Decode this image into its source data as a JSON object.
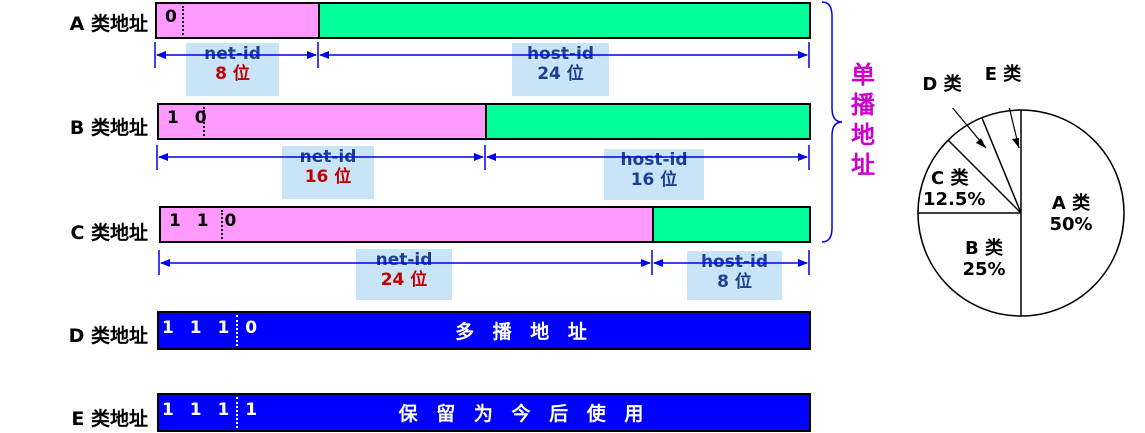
{
  "rows": {
    "a": {
      "label": "A 类地址",
      "prefix": "0",
      "net_label": "net-id",
      "net_bits": "8 位",
      "host_label": "host-id",
      "host_bits": "24 位"
    },
    "b": {
      "label": "B 类地址",
      "prefix": "1 0",
      "net_label": "net-id",
      "net_bits": "16 位",
      "host_label": "host-id",
      "host_bits": "16 位"
    },
    "c": {
      "label": "C 类地址",
      "prefix": "1 1 0",
      "net_label": "net-id",
      "net_bits": "24 位",
      "host_label": "host-id",
      "host_bits": "8 位"
    },
    "d": {
      "label": "D 类地址",
      "prefix": "1 1 1 0",
      "text": "多 播 地 址"
    },
    "e": {
      "label": "E 类地址",
      "prefix": "1 1 1 1",
      "text": "保 留 为 今 后 使 用"
    }
  },
  "unicast_label": "单播地址",
  "pie": {
    "a": {
      "name": "A 类",
      "pct": "50%"
    },
    "b": {
      "name": "B 类",
      "pct": "25%"
    },
    "c": {
      "name": "C 类",
      "pct": "12.5%"
    },
    "d": {
      "name": "D 类"
    },
    "e": {
      "name": "E 类"
    }
  },
  "colors": {
    "net": "#ff99ff",
    "host": "#00ff99",
    "special": "#0000ff",
    "label_bg": "#c9e4f7",
    "unicast": "#cc00cc",
    "bits": "#c00000"
  }
}
